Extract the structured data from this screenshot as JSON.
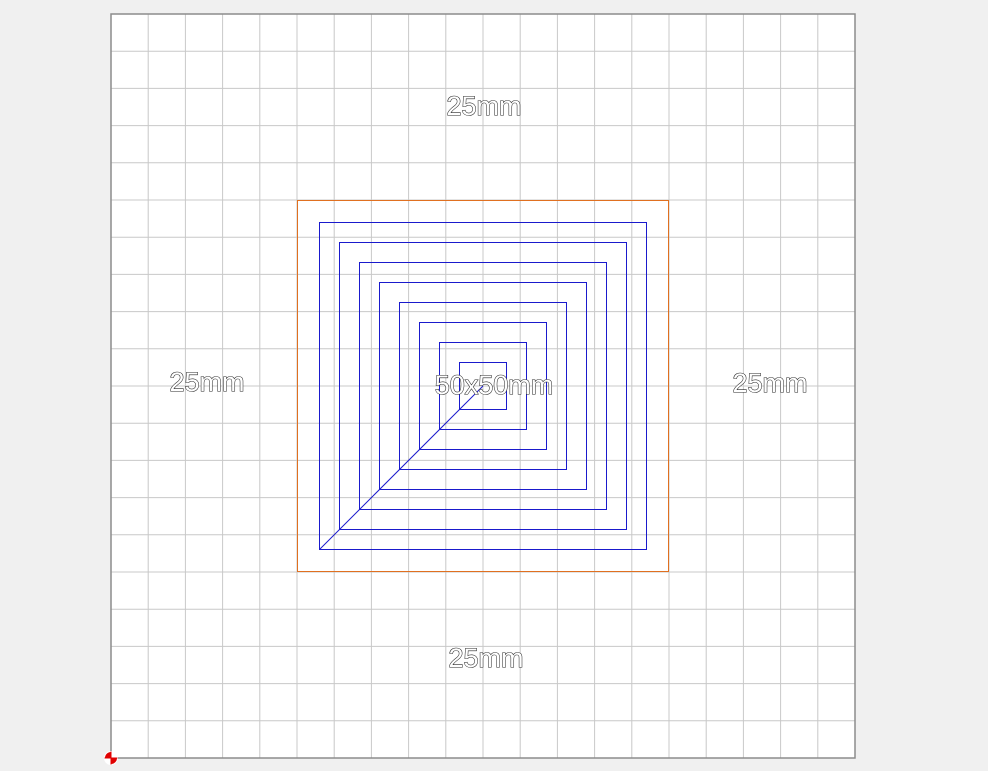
{
  "labels": {
    "top": "25mm",
    "left": "25mm",
    "right": "25mm",
    "bottom": "25mm",
    "center": "50x50mm"
  },
  "colors": {
    "background": "#f0f0f0",
    "workspace": "#ffffff",
    "grid": "#c8c8c8",
    "border": "#8c8c8c",
    "boundary": "#e07020",
    "toolpath": "#1a1acc",
    "origin": "#e00000"
  },
  "icons": {
    "origin_marker": "origin-crosshair-icon"
  }
}
